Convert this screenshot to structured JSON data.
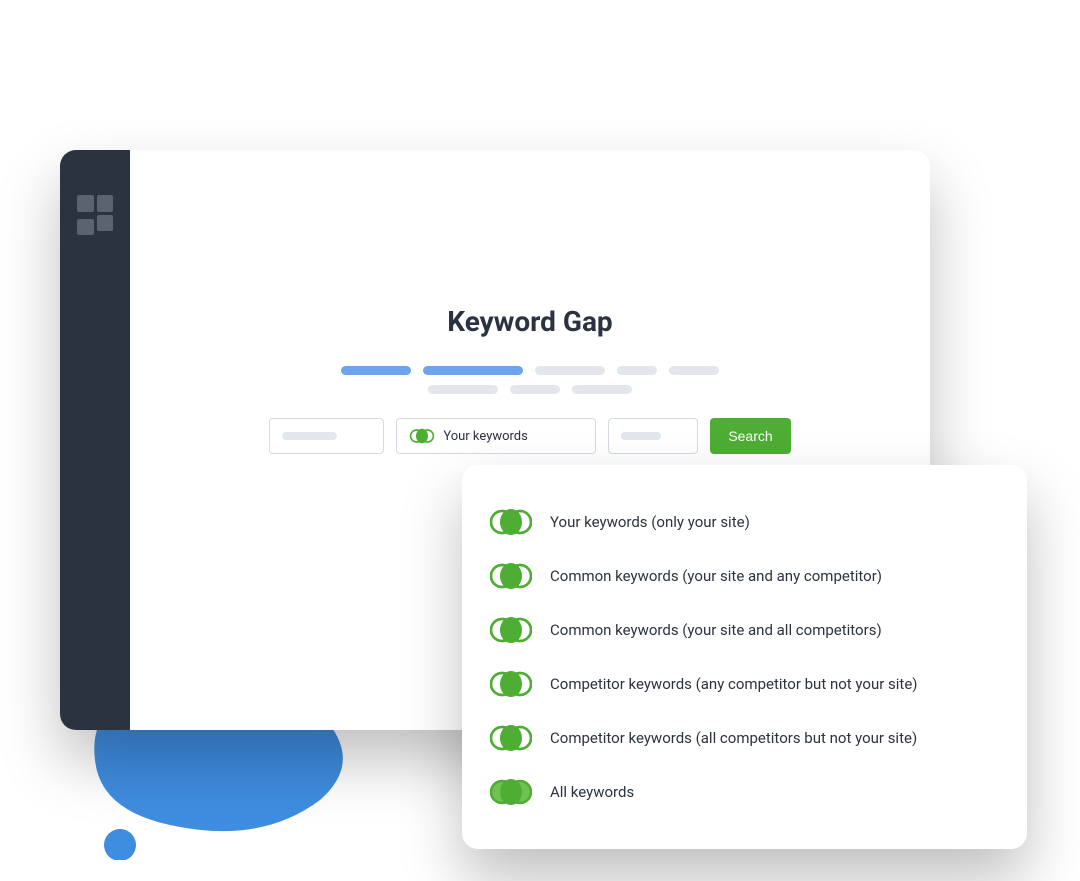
{
  "page": {
    "title": "Keyword Gap"
  },
  "inputRow": {
    "keywordSelector": {
      "label": "Your keywords"
    },
    "searchButton": "Search"
  },
  "dropdown": {
    "options": [
      {
        "label": "Your keywords (only your site)"
      },
      {
        "label": "Common keywords (your site and any competitor)"
      },
      {
        "label": "Common keywords (your site and all competitors)"
      },
      {
        "label": "Competitor keywords (any competitor but not your site)"
      },
      {
        "label": "Competitor keywords (all competitors but not your site)"
      },
      {
        "label": "All keywords"
      }
    ]
  },
  "colors": {
    "sidebar": "#2b3340",
    "accentBlue": "#6ca5ee",
    "accentGreen": "#4ead33",
    "blobBlue": "#3f8de0"
  }
}
